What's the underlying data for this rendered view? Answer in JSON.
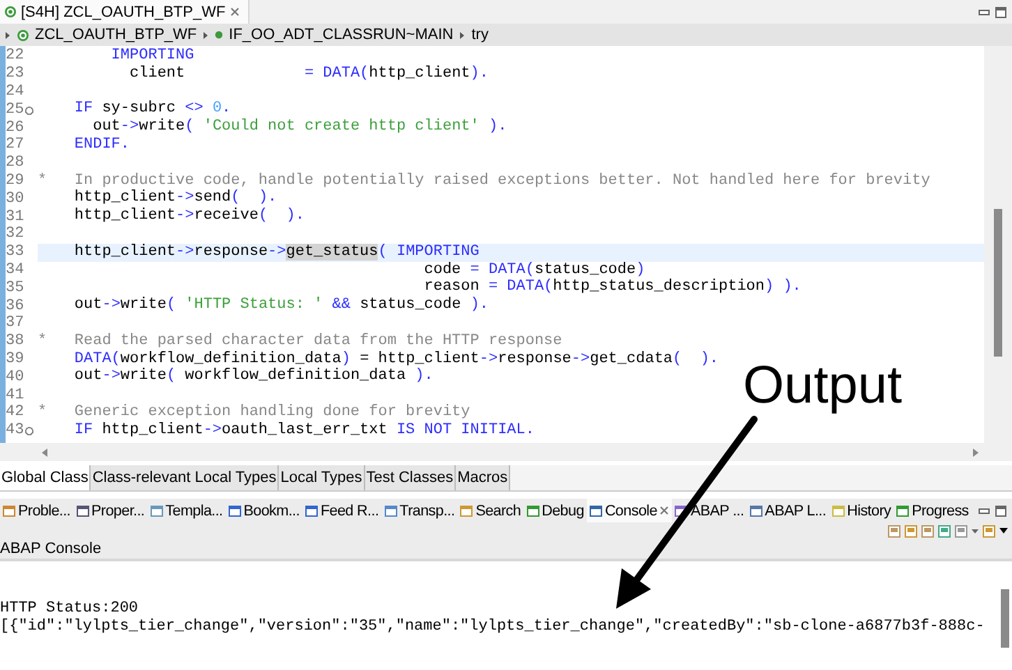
{
  "editor_tab": {
    "title": "[S4H] ZCL_OAUTH_BTP_WF"
  },
  "breadcrumb": [
    "ZCL_OAUTH_BTP_WF",
    "IF_OO_ADT_CLASSRUN~MAIN",
    "try"
  ],
  "editor": {
    "lines": [
      {
        "number": "22",
        "fold": false,
        "current": false,
        "tokens": [
          {
            "kind": "kw",
            "text": "        IMPORTING"
          }
        ]
      },
      {
        "number": "23",
        "fold": false,
        "current": false,
        "tokens": [
          {
            "kind": "plain",
            "text": "          client             "
          },
          {
            "kind": "kw",
            "text": "= DATA("
          },
          {
            "kind": "plain",
            "text": "http_client"
          },
          {
            "kind": "kw",
            "text": ")."
          }
        ]
      },
      {
        "number": "24",
        "fold": false,
        "current": false
      },
      {
        "number": "25",
        "fold": true,
        "current": false,
        "tokens": [
          {
            "kind": "kw",
            "text": "    IF"
          },
          {
            "kind": "plain",
            "text": " sy-subrc "
          },
          {
            "kind": "kw",
            "text": "<> "
          },
          {
            "kind": "num",
            "text": "0"
          },
          {
            "kind": "kw",
            "text": "."
          }
        ]
      },
      {
        "number": "26",
        "fold": false,
        "current": false,
        "tokens": [
          {
            "kind": "plain",
            "text": "      out"
          },
          {
            "kind": "kw",
            "text": "->"
          },
          {
            "kind": "plain",
            "text": "write"
          },
          {
            "kind": "kw",
            "text": "( "
          },
          {
            "kind": "str",
            "text": "'Could not create http client'"
          },
          {
            "kind": "kw",
            "text": " )."
          }
        ]
      },
      {
        "number": "27",
        "fold": false,
        "current": false,
        "tokens": [
          {
            "kind": "kw",
            "text": "    ENDIF."
          }
        ]
      },
      {
        "number": "28",
        "fold": false,
        "current": false
      },
      {
        "number": "29",
        "fold": false,
        "current": false,
        "tokens": [
          {
            "kind": "cmt",
            "text": "*   In productive code, handle potentially raised exceptions better. Not handled here for brevity"
          }
        ]
      },
      {
        "number": "30",
        "fold": false,
        "current": false,
        "tokens": [
          {
            "kind": "plain",
            "text": "    http_client"
          },
          {
            "kind": "kw",
            "text": "->"
          },
          {
            "kind": "plain",
            "text": "send"
          },
          {
            "kind": "kw",
            "text": "(  )."
          }
        ]
      },
      {
        "number": "31",
        "fold": false,
        "current": false,
        "tokens": [
          {
            "kind": "plain",
            "text": "    http_client"
          },
          {
            "kind": "kw",
            "text": "->"
          },
          {
            "kind": "plain",
            "text": "receive"
          },
          {
            "kind": "kw",
            "text": "(  )."
          }
        ]
      },
      {
        "number": "32",
        "fold": false,
        "current": false
      },
      {
        "number": "33",
        "fold": false,
        "current": true,
        "tokens": [
          {
            "kind": "plain",
            "text": "    http_client"
          },
          {
            "kind": "kw",
            "text": "->"
          },
          {
            "kind": "plain",
            "text": "response"
          },
          {
            "kind": "kw",
            "text": "->"
          },
          {
            "kind": "mark",
            "text": "get_status"
          },
          {
            "kind": "kw",
            "text": "( IMPORTING"
          }
        ]
      },
      {
        "number": "34",
        "fold": false,
        "current": false,
        "tokens": [
          {
            "kind": "plain",
            "text": "                                          code "
          },
          {
            "kind": "kw",
            "text": "= DATA("
          },
          {
            "kind": "plain",
            "text": "status_code"
          },
          {
            "kind": "kw",
            "text": ")"
          }
        ]
      },
      {
        "number": "35",
        "fold": false,
        "current": false,
        "tokens": [
          {
            "kind": "plain",
            "text": "                                          reason "
          },
          {
            "kind": "kw",
            "text": "= DATA("
          },
          {
            "kind": "plain",
            "text": "http_status_description"
          },
          {
            "kind": "kw",
            "text": ") )."
          }
        ]
      },
      {
        "number": "36",
        "fold": false,
        "current": false,
        "tokens": [
          {
            "kind": "plain",
            "text": "    out"
          },
          {
            "kind": "kw",
            "text": "->"
          },
          {
            "kind": "plain",
            "text": "write"
          },
          {
            "kind": "kw",
            "text": "( "
          },
          {
            "kind": "str",
            "text": "'HTTP Status: '"
          },
          {
            "kind": "kw",
            "text": " &&"
          },
          {
            "kind": "plain",
            "text": " status_code "
          },
          {
            "kind": "kw",
            "text": ")."
          }
        ]
      },
      {
        "number": "37",
        "fold": false,
        "current": false
      },
      {
        "number": "38",
        "fold": false,
        "current": false,
        "tokens": [
          {
            "kind": "cmt",
            "text": "*   Read the parsed character data from the HTTP response"
          }
        ]
      },
      {
        "number": "39",
        "fold": false,
        "current": false,
        "tokens": [
          {
            "kind": "kw",
            "text": "    DATA("
          },
          {
            "kind": "plain",
            "text": "workflow_definition_data"
          },
          {
            "kind": "kw",
            "text": ")"
          },
          {
            "kind": "plain",
            "text": " = http_client"
          },
          {
            "kind": "kw",
            "text": "->"
          },
          {
            "kind": "plain",
            "text": "response"
          },
          {
            "kind": "kw",
            "text": "->"
          },
          {
            "kind": "plain",
            "text": "get_cdata"
          },
          {
            "kind": "kw",
            "text": "(  )."
          }
        ]
      },
      {
        "number": "40",
        "fold": false,
        "current": false,
        "tokens": [
          {
            "kind": "plain",
            "text": "    out"
          },
          {
            "kind": "kw",
            "text": "->"
          },
          {
            "kind": "plain",
            "text": "write"
          },
          {
            "kind": "kw",
            "text": "( "
          },
          {
            "kind": "plain",
            "text": "workflow_definition_data "
          },
          {
            "kind": "kw",
            "text": ")."
          }
        ]
      },
      {
        "number": "41",
        "fold": false,
        "current": false
      },
      {
        "number": "42",
        "fold": false,
        "current": false,
        "tokens": [
          {
            "kind": "cmt",
            "text": "*   Generic exception handling done for brevity"
          }
        ]
      },
      {
        "number": "43",
        "fold": true,
        "current": false,
        "tokens": [
          {
            "kind": "kw",
            "text": "    IF"
          },
          {
            "kind": "plain",
            "text": " http_client"
          },
          {
            "kind": "kw",
            "text": "->"
          },
          {
            "kind": "plain",
            "text": "oauth_last_err_txt "
          },
          {
            "kind": "kw",
            "text": "IS NOT INITIAL."
          }
        ]
      }
    ]
  },
  "class_tabs": [
    {
      "label": "Global Class",
      "selected": true
    },
    {
      "label": "Class-relevant Local Types",
      "selected": false
    },
    {
      "label": "Local Types",
      "selected": false
    },
    {
      "label": "Test Classes",
      "selected": false
    },
    {
      "label": "Macros",
      "selected": false
    }
  ],
  "view_tabs": [
    {
      "label": "Proble...",
      "selected": false
    },
    {
      "label": "Proper...",
      "selected": false
    },
    {
      "label": "Templa...",
      "selected": false
    },
    {
      "label": "Bookm...",
      "selected": false
    },
    {
      "label": "Feed R...",
      "selected": false
    },
    {
      "label": "Transp...",
      "selected": false
    },
    {
      "label": "Search",
      "selected": false
    },
    {
      "label": "Debug",
      "selected": false
    },
    {
      "label": "Console",
      "selected": true
    },
    {
      "label": "ABAP ...",
      "selected": false
    },
    {
      "label": "ABAP L...",
      "selected": false
    },
    {
      "label": "History",
      "selected": false
    },
    {
      "label": "Progress",
      "selected": false
    }
  ],
  "console": {
    "title": "ABAP Console",
    "lines": [
      "HTTP Status:200",
      "[{\"id\":\"lylpts_tier_change\",\"version\":\"35\",\"name\":\"lylpts_tier_change\",\"createdBy\":\"sb-clone-a6877b3f-888c-"
    ]
  },
  "annotation": {
    "label": "Output"
  }
}
